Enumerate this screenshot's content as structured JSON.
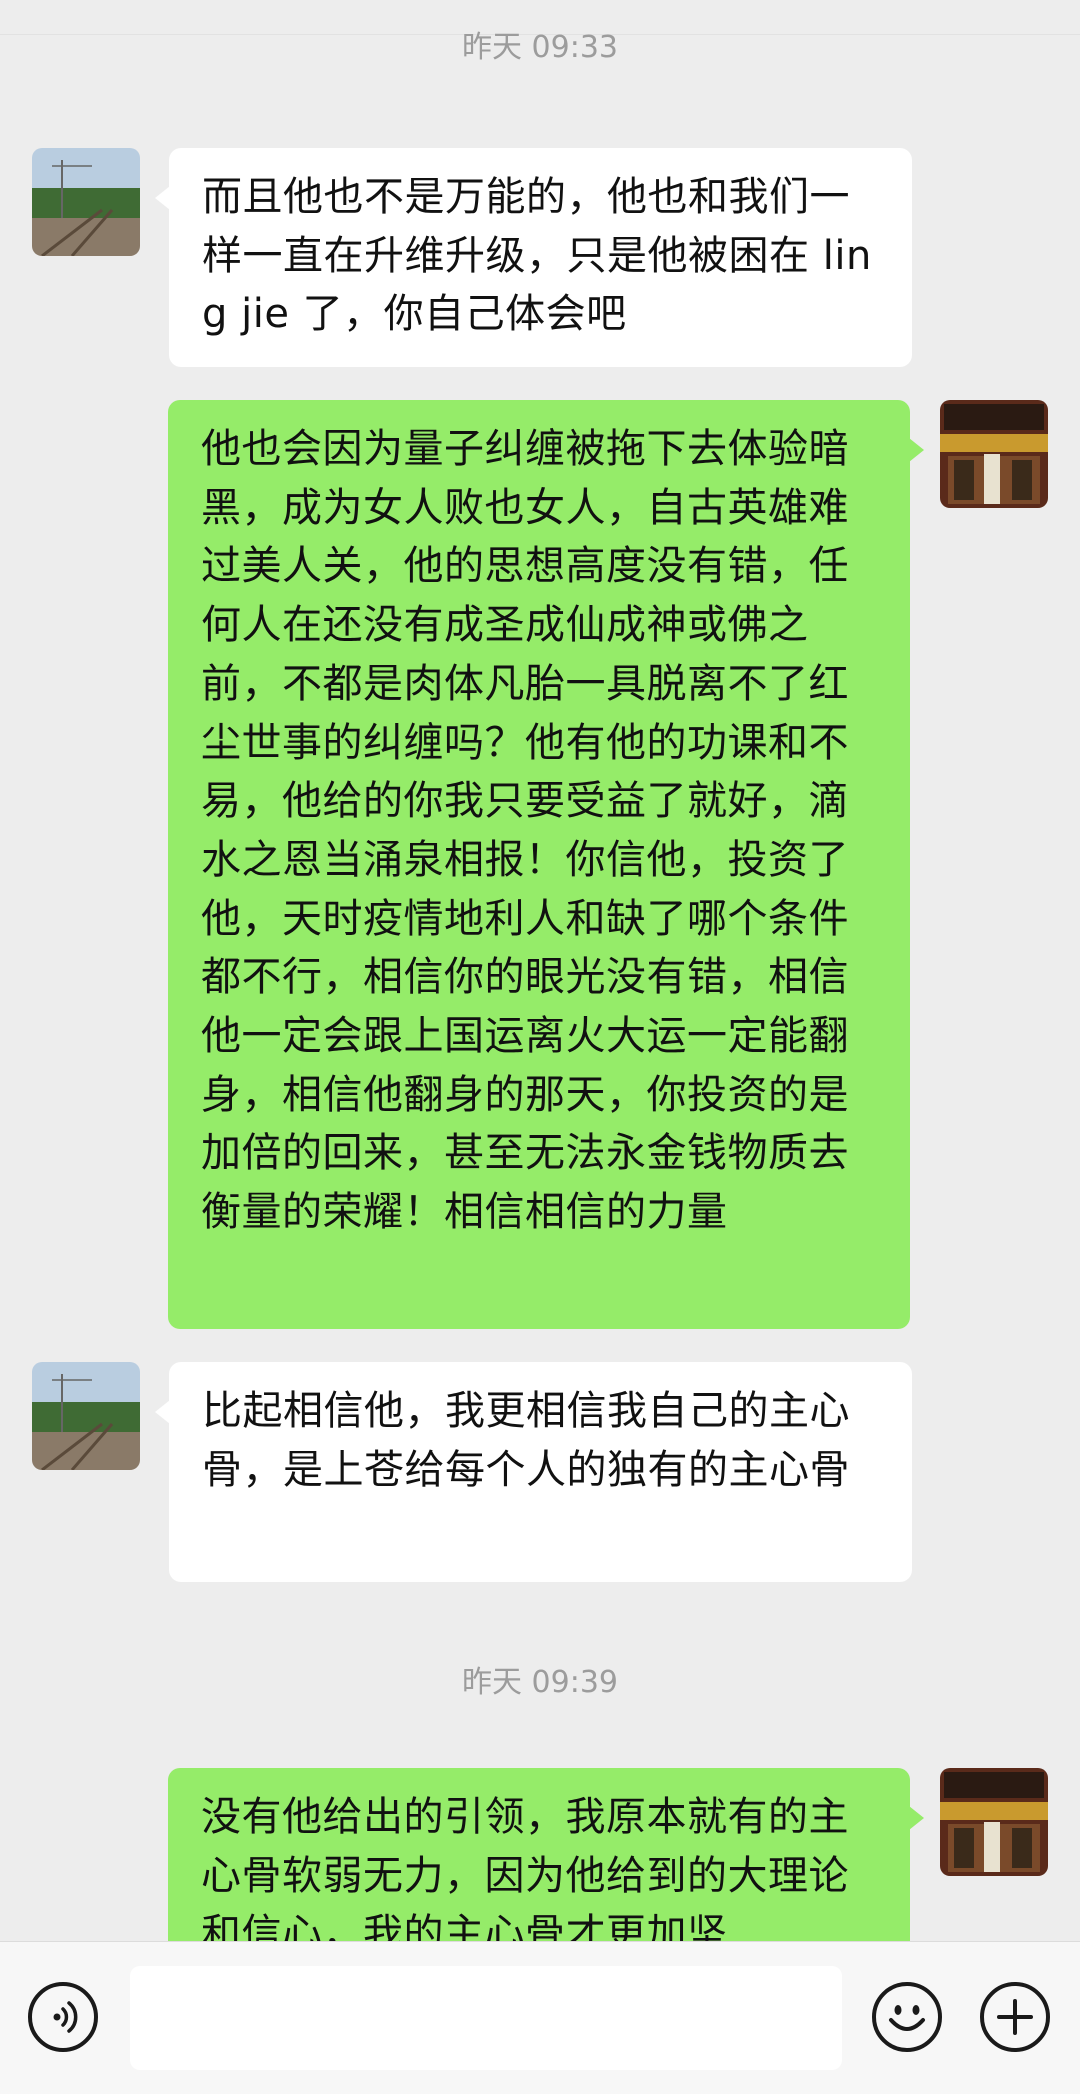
{
  "chat": {
    "timestamps": [
      "昨天 09:33",
      "昨天 09:39"
    ],
    "messages": [
      {
        "side": "in",
        "text": "而且他也不是万能的，他也和我们一样一直在升维升级，只是他被困在 ling jie 了，你自己体会吧"
      },
      {
        "side": "out",
        "text": "他也会因为量子纠缠被拖下去体验暗黑，成为女人败也女人，自古英雄难过美人关，他的思想高度没有错，任何人在还没有成圣成仙成神或佛之前，不都是肉体凡胎一具脱离不了红尘世事的纠缠吗？他有他的功课和不易，他给的你我只要受益了就好，滴水之恩当涌泉相报！你信他，投资了他，天时疫情地利人和缺了哪个条件都不行，相信你的眼光没有错，相信他一定会跟上国运离火大运一定能翻身，相信他翻身的那天，你投资的是加倍的回来，甚至无法永金钱物质去衡量的荣耀！相信相信的力量"
      },
      {
        "side": "in",
        "text": "比起相信他，我更相信我自己的主心骨，是上苍给每个人的独有的主心骨"
      },
      {
        "side": "out",
        "text": "没有他给出的引领，我原本就有的主心骨软弱无力，因为他给到的大理论和信心，我的主心骨才更加坚"
      }
    ],
    "avatars": {
      "contact": "railway-photo-avatar",
      "self": "shop-sign-avatar"
    }
  },
  "input_bar": {
    "icons": [
      "voice-icon",
      "emoji-icon",
      "plus-icon"
    ]
  }
}
